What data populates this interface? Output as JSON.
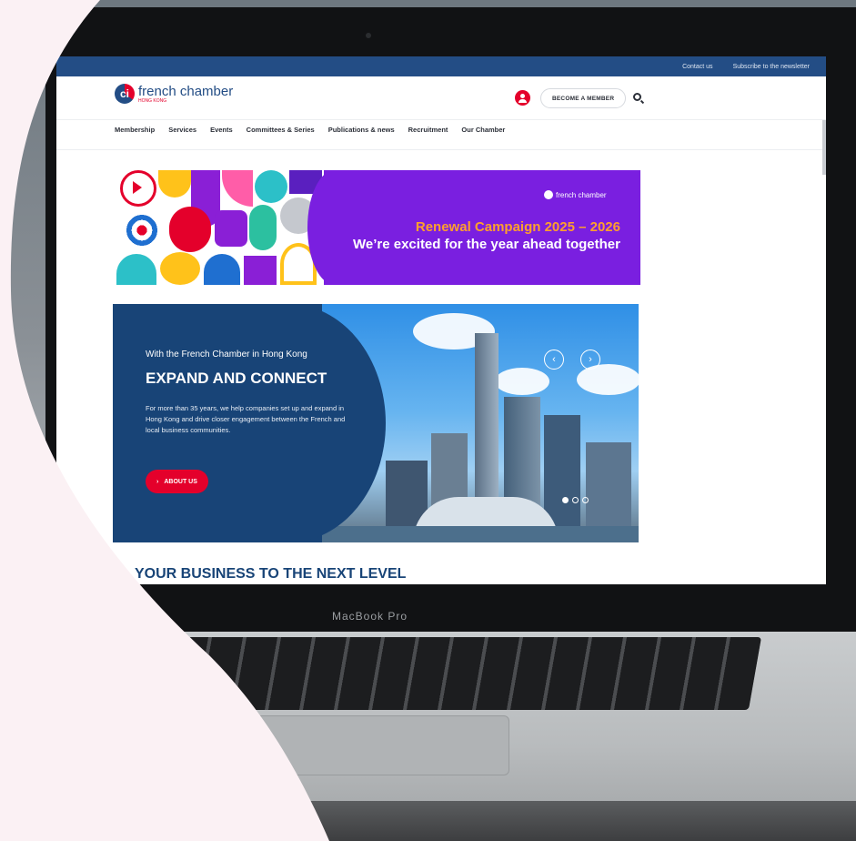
{
  "topbar": {
    "links": [
      "Contact us",
      "Subscribe to the newsletter"
    ]
  },
  "header": {
    "logo_name": "french chamber",
    "logo_sub": "HONG KONG",
    "logo_mark": "ci",
    "member_button": "BECOME A MEMBER"
  },
  "nav": {
    "items": [
      "Membership",
      "Services",
      "Events",
      "Committees & Series",
      "Publications & news",
      "Recruitment",
      "Our Chamber"
    ]
  },
  "banner": {
    "logo_text": "french chamber",
    "line1": "Renewal Campaign 2025 – 2026",
    "line2": "We’re excited for the year ahead together"
  },
  "hero": {
    "kicker": "With the French Chamber in Hong Kong",
    "title": "EXPAND AND CONNECT",
    "body": "For more than 35 years, we help companies set up and expand in Hong Kong and drive closer engagement between the French and local business communities.",
    "button": "ABOUT US",
    "prev_arrow": "‹",
    "next_arrow": "›",
    "slides": 3,
    "active_slide": 1
  },
  "section": {
    "title": "YOUR BUSINESS TO THE NEXT LEVEL"
  },
  "laptop": {
    "brand": "MacBook Pro"
  },
  "colors": {
    "brand_blue": "#234d85",
    "hero_blue": "#184477",
    "brand_red": "#e4002b",
    "banner_purple": "#7a1fe0",
    "banner_orange": "#ff9f2d",
    "swoosh_pink": "#fbf1f4"
  },
  "icons": [
    "user-icon",
    "search-icon",
    "chevron-left-icon",
    "chevron-right-icon",
    "chevron-right-small-icon"
  ]
}
